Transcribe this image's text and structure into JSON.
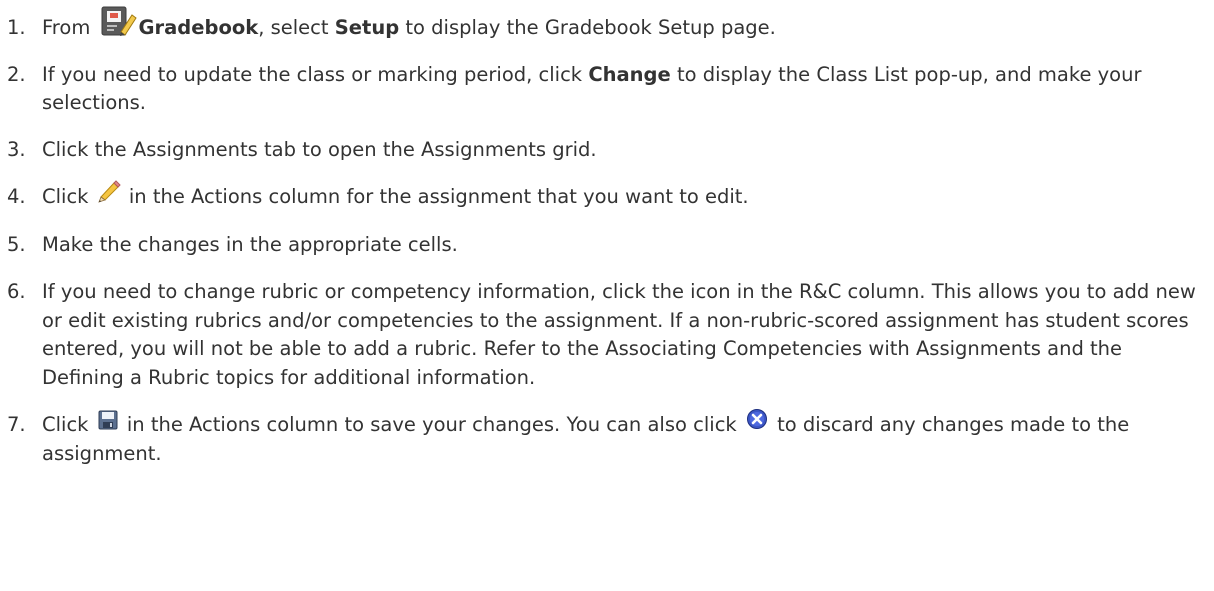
{
  "steps": [
    {
      "num": "1.",
      "from": "From",
      "gradebook": "Gradebook",
      "select": ", select",
      "setup": "Setup",
      "to_display": "to display the",
      "setup_page": "Gradebook Setup page."
    },
    {
      "num": "2.",
      "text_a": "If you need to update the class or marking period, click",
      "change": "Change",
      "text_b": "to display the",
      "class_list": "Class List",
      "text_c": "pop-up, and make your selections."
    },
    {
      "num": "3.",
      "text": "Click the Assignments tab to open the Assignments grid."
    },
    {
      "num": "4.",
      "click": "Click",
      "rest": "in the Actions column for the assignment that you want to edit."
    },
    {
      "num": "5.",
      "text": "Make the changes in the appropriate cells."
    },
    {
      "num": "6.",
      "text_a": "If you need to change rubric or competency information, click the icon in the R&C column. This allows you to add new or edit existing rubrics and/or competencies to the assignment. If a non-rubric-scored assignment has student scores entered, you will not be able to add a rubric. Refer to the",
      "link_1": "Associating Competencies with Assignments",
      "and_the": "and the",
      "link_2": "Defining a Rubric",
      "text_b": "topics for additional information."
    },
    {
      "num": "7.",
      "click": "Click",
      "text_a": "in the Actions column to save your changes. You can also click",
      "text_b": "to discard any changes made to the assignment."
    }
  ],
  "icons": {
    "gradebook": "gradebook-icon",
    "pencil": "pencil-icon",
    "save": "save-icon",
    "cancel": "cancel-icon"
  }
}
